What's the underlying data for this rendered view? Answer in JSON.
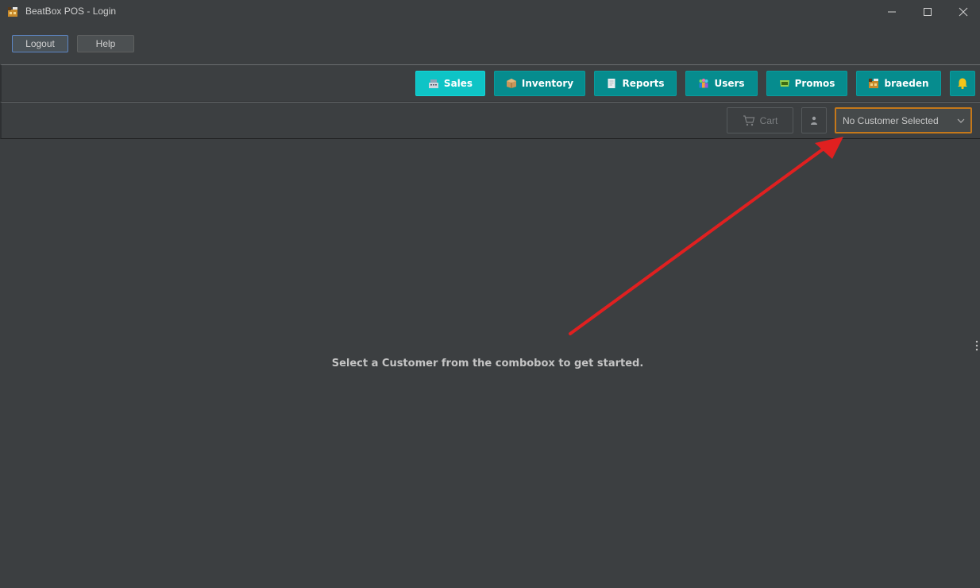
{
  "window": {
    "title": "BeatBox POS - Login",
    "controls": [
      "minimize-icon",
      "maximize-icon",
      "close-icon"
    ]
  },
  "toolbar": {
    "logout_label": "Logout",
    "help_label": "Help"
  },
  "nav": {
    "items": [
      {
        "label": "Sales",
        "icon": "cash-register-icon",
        "active": true
      },
      {
        "label": "Inventory",
        "icon": "package-icon",
        "active": false
      },
      {
        "label": "Reports",
        "icon": "document-icon",
        "active": false
      },
      {
        "label": "Users",
        "icon": "users-icon",
        "active": false
      },
      {
        "label": "Promos",
        "icon": "ticket-icon",
        "active": false
      },
      {
        "label": "braeden",
        "icon": "cinema-icon",
        "active": false
      }
    ],
    "notification_icon": "bell-icon"
  },
  "customer_bar": {
    "cart_label": "Cart",
    "cart_icon": "cart-icon",
    "person_icon": "person-icon",
    "customer_combo_value": "No Customer Selected"
  },
  "main": {
    "message": "Select a Customer from the combobox to get started."
  },
  "colors": {
    "background": "#3c3f41",
    "nav_button": "#068c8e",
    "nav_button_active": "#0ec4c6",
    "bell": "#f5c518",
    "combo_border": "#c5781a",
    "annotation_arrow": "#e02020"
  }
}
